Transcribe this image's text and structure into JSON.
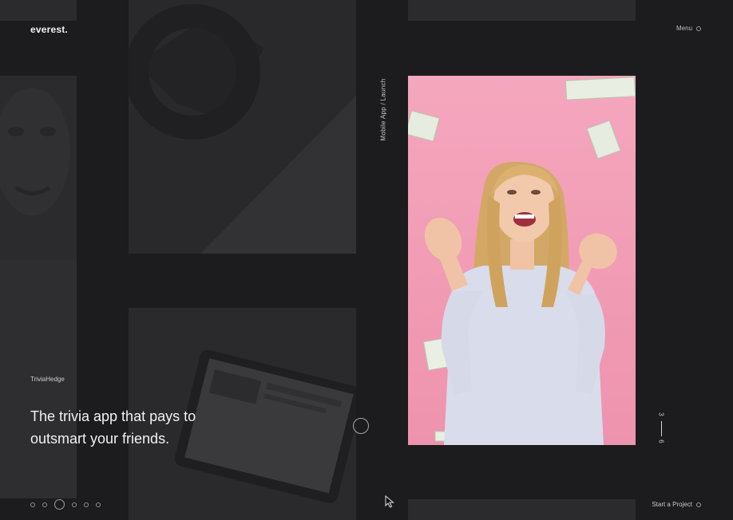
{
  "brand": {
    "logo": "everest."
  },
  "header": {
    "menu_label": "Menu"
  },
  "project": {
    "category": "Mobile App / Launch",
    "client": "TriviaHedge",
    "headline_line1": "The trivia app that pays to",
    "headline_line2": "outsmart your friends."
  },
  "pager": {
    "current": "3",
    "total": "6"
  },
  "footer": {
    "cta": "Start a Project"
  },
  "nav_dots": {
    "count": 6,
    "active_index": 2
  },
  "colors": {
    "background": "#1c1c1e",
    "hero_pink": "#f29cb6",
    "text": "#f1f1f1"
  }
}
